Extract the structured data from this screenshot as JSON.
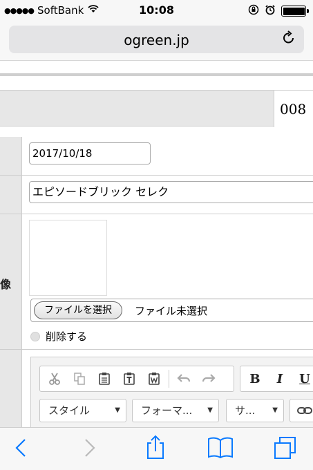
{
  "status_bar": {
    "carrier": "SoftBank",
    "time": "10:08",
    "icons": [
      "signal-dots",
      "wifi-icon",
      "orientation-lock-icon",
      "alarm-icon",
      "battery-icon"
    ]
  },
  "browser": {
    "url": "ogreen.jp",
    "reload_icon": "reload-icon"
  },
  "header": {
    "record_id": "008"
  },
  "form": {
    "date_value": "2017/10/18",
    "title_value": "エピソードブリック セレク",
    "image_label_char": "像",
    "file_button": "ファイルを選択",
    "file_status": "ファイル未選択",
    "delete_label": "削除する"
  },
  "editor_toolbar": {
    "group1": [
      "cut-icon",
      "copy-icon",
      "paste-icon",
      "paste-text-icon",
      "paste-word-icon",
      "undo-icon",
      "redo-icon"
    ],
    "group2": [
      "B",
      "I",
      "U"
    ],
    "style_combo": "スタイル",
    "format_combo": "フォーマ...",
    "size_combo": "サ...",
    "link_icon": "link-icon"
  },
  "bottom_bar": {
    "icons": [
      "back-icon",
      "forward-icon",
      "share-icon",
      "bookmarks-icon",
      "tabs-icon"
    ]
  }
}
